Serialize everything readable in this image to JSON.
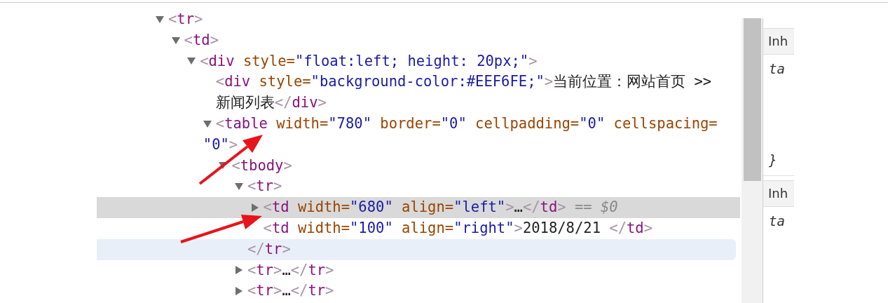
{
  "elements_tree": [
    {
      "selected": false,
      "expanded": true,
      "rows": [
        {
          "tokens": [
            {
              "kind": "bracket",
              "text": "<"
            },
            {
              "kind": "tag",
              "text": "tr"
            },
            {
              "kind": "bracket",
              "text": ">"
            }
          ]
        }
      ],
      "children": [
        {
          "selected": false,
          "expanded": true,
          "rows": [
            {
              "tokens": [
                {
                  "kind": "bracket",
                  "text": "<"
                },
                {
                  "kind": "tag",
                  "text": "td"
                },
                {
                  "kind": "bracket",
                  "text": ">"
                }
              ]
            }
          ],
          "children": [
            {
              "selected": false,
              "expanded": true,
              "rows": [
                {
                  "tokens": [
                    {
                      "kind": "bracket",
                      "text": "<"
                    },
                    {
                      "kind": "tag",
                      "text": "div"
                    },
                    {
                      "kind": "attr",
                      "text": " style="
                    },
                    {
                      "kind": "value",
                      "text": "\"float:left; height: 20px;\""
                    },
                    {
                      "kind": "bracket",
                      "text": ">"
                    }
                  ]
                }
              ],
              "children": [
                {
                  "selected": false,
                  "rows": [
                    {
                      "tokens": [
                        {
                          "kind": "bracket",
                          "text": "<"
                        },
                        {
                          "kind": "tag",
                          "text": "div"
                        },
                        {
                          "kind": "attr",
                          "text": " style="
                        },
                        {
                          "kind": "value",
                          "text": "\"background-color:#EEF6FE;\""
                        },
                        {
                          "kind": "bracket",
                          "text": ">"
                        },
                        {
                          "kind": "text",
                          "text": "当前位置：网站首页 >>"
                        }
                      ]
                    },
                    {
                      "tokens": [
                        {
                          "kind": "text",
                          "text": "新闻列表"
                        },
                        {
                          "kind": "bracket",
                          "text": "</"
                        },
                        {
                          "kind": "tag",
                          "text": "div"
                        },
                        {
                          "kind": "bracket",
                          "text": ">"
                        }
                      ]
                    }
                  ]
                },
                {
                  "selected": false,
                  "expanded": true,
                  "rows": [
                    {
                      "tokens": [
                        {
                          "kind": "bracket",
                          "text": "<"
                        },
                        {
                          "kind": "tag",
                          "text": "table"
                        },
                        {
                          "kind": "attr",
                          "text": " width="
                        },
                        {
                          "kind": "value",
                          "text": "\"780\""
                        },
                        {
                          "kind": "attr",
                          "text": " border="
                        },
                        {
                          "kind": "value",
                          "text": "\"0\""
                        },
                        {
                          "kind": "attr",
                          "text": " cellpadding="
                        },
                        {
                          "kind": "value",
                          "text": "\"0\""
                        },
                        {
                          "kind": "attr",
                          "text": " cellspacing="
                        }
                      ]
                    },
                    {
                      "tokens": [
                        {
                          "kind": "value",
                          "text": "\"0\""
                        },
                        {
                          "kind": "bracket",
                          "text": ">"
                        }
                      ]
                    }
                  ],
                  "children": [
                    {
                      "selected": false,
                      "expanded": true,
                      "rows": [
                        {
                          "tokens": [
                            {
                              "kind": "bracket",
                              "text": "<"
                            },
                            {
                              "kind": "tag",
                              "text": "tbody"
                            },
                            {
                              "kind": "bracket",
                              "text": ">"
                            }
                          ]
                        }
                      ],
                      "children": [
                        {
                          "selected": false,
                          "expanded": true,
                          "rows": [
                            {
                              "tokens": [
                                {
                                  "kind": "bracket",
                                  "text": "<"
                                },
                                {
                                  "kind": "tag",
                                  "text": "tr"
                                },
                                {
                                  "kind": "bracket",
                                  "text": ">"
                                }
                              ]
                            }
                          ],
                          "children": [
                            {
                              "selected": true,
                              "expanded": false,
                              "rows": [
                                {
                                  "tokens": [
                                    {
                                      "kind": "bracket",
                                      "text": "<"
                                    },
                                    {
                                      "kind": "tag",
                                      "text": "td"
                                    },
                                    {
                                      "kind": "attr",
                                      "text": " width="
                                    },
                                    {
                                      "kind": "value",
                                      "text": "\"680\""
                                    },
                                    {
                                      "kind": "attr",
                                      "text": " align="
                                    },
                                    {
                                      "kind": "value",
                                      "text": "\"left\""
                                    },
                                    {
                                      "kind": "bracket",
                                      "text": ">"
                                    },
                                    {
                                      "kind": "text",
                                      "text": "…"
                                    },
                                    {
                                      "kind": "bracket",
                                      "text": "</"
                                    },
                                    {
                                      "kind": "tag",
                                      "text": "td"
                                    },
                                    {
                                      "kind": "bracket",
                                      "text": ">"
                                    },
                                    {
                                      "kind": "ref",
                                      "text": " == $0"
                                    }
                                  ]
                                }
                              ]
                            },
                            {
                              "selected": false,
                              "rows": [
                                {
                                  "tokens": [
                                    {
                                      "kind": "bracket",
                                      "text": "<"
                                    },
                                    {
                                      "kind": "tag",
                                      "text": "td"
                                    },
                                    {
                                      "kind": "attr",
                                      "text": " width="
                                    },
                                    {
                                      "kind": "value",
                                      "text": "\"100\""
                                    },
                                    {
                                      "kind": "attr",
                                      "text": " align="
                                    },
                                    {
                                      "kind": "value",
                                      "text": "\"right\""
                                    },
                                    {
                                      "kind": "bracket",
                                      "text": ">"
                                    },
                                    {
                                      "kind": "text",
                                      "text": "2018/8/21 "
                                    },
                                    {
                                      "kind": "bracket",
                                      "text": "</"
                                    },
                                    {
                                      "kind": "tag",
                                      "text": "td"
                                    },
                                    {
                                      "kind": "bracket",
                                      "text": ">"
                                    }
                                  ]
                                }
                              ]
                            }
                          ],
                          "closing": {
                            "hovered": true,
                            "tokens": [
                              {
                                "kind": "bracket",
                                "text": "</"
                              },
                              {
                                "kind": "tag",
                                "text": "tr"
                              },
                              {
                                "kind": "bracket",
                                "text": ">"
                              }
                            ]
                          }
                        },
                        {
                          "selected": false,
                          "expanded": false,
                          "rows": [
                            {
                              "tokens": [
                                {
                                  "kind": "bracket",
                                  "text": "<"
                                },
                                {
                                  "kind": "tag",
                                  "text": "tr"
                                },
                                {
                                  "kind": "bracket",
                                  "text": ">"
                                },
                                {
                                  "kind": "text",
                                  "text": "…"
                                },
                                {
                                  "kind": "bracket",
                                  "text": "</"
                                },
                                {
                                  "kind": "tag",
                                  "text": "tr"
                                },
                                {
                                  "kind": "bracket",
                                  "text": ">"
                                }
                              ]
                            }
                          ]
                        },
                        {
                          "selected": false,
                          "expanded": false,
                          "rows": [
                            {
                              "tokens": [
                                {
                                  "kind": "bracket",
                                  "text": "<"
                                },
                                {
                                  "kind": "tag",
                                  "text": "tr"
                                },
                                {
                                  "kind": "bracket",
                                  "text": ">"
                                },
                                {
                                  "kind": "text",
                                  "text": "…"
                                },
                                {
                                  "kind": "bracket",
                                  "text": "</"
                                },
                                {
                                  "kind": "tag",
                                  "text": "tr"
                                },
                                {
                                  "kind": "bracket",
                                  "text": ">"
                                }
                              ]
                            }
                          ]
                        }
                      ]
                    }
                  ]
                }
              ]
            }
          ]
        }
      ]
    }
  ],
  "styles_pane": {
    "sections": [
      {
        "header": "Inh",
        "selector": "ta",
        "closing": "}"
      },
      {
        "header": "Inh",
        "selector": "ta"
      }
    ]
  }
}
